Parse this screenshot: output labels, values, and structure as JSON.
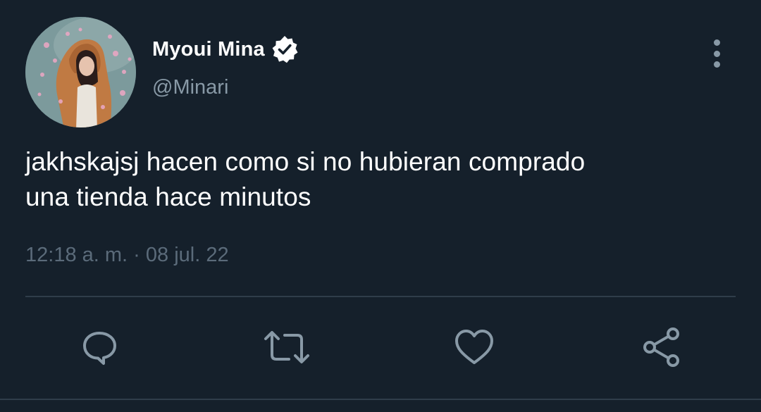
{
  "user": {
    "display_name": "Myoui Mina",
    "handle": "@Minari",
    "verified": true,
    "avatar_icon": "profile-photo"
  },
  "tweet": {
    "text_line1": "jakhskajsj hacen como si no hubieran comprado",
    "text_line2": "una tienda hace minutos",
    "time": "12:18 a. m.",
    "separator": "·",
    "date": "08 jul. 22"
  },
  "actions": [
    {
      "icon": "reply-icon"
    },
    {
      "icon": "retweet-icon"
    },
    {
      "icon": "like-icon"
    },
    {
      "icon": "share-icon"
    }
  ],
  "colors": {
    "background": "#15202b",
    "text_primary": "#ffffff",
    "text_secondary": "#8899a6",
    "timestamp": "#5b6b7a",
    "divider": "#2f3d4a",
    "icon": "#8899a6"
  }
}
